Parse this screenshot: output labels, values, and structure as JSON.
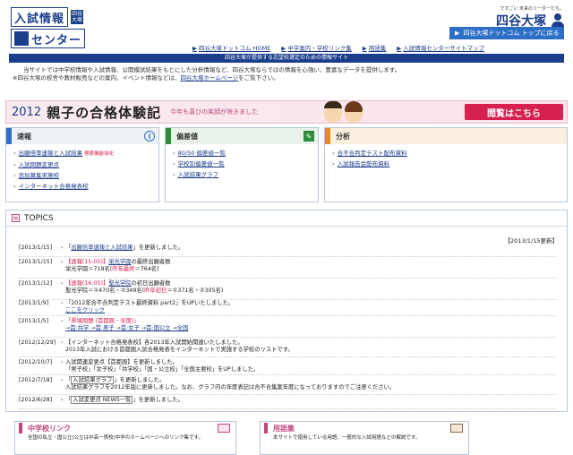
{
  "header": {
    "logo_line1": "入試情報",
    "logo_mini": "四谷大塚",
    "logo_line2": "センター",
    "brand_tagline": "ですごい 未来のリーダーたち。",
    "brand_name": "四谷大塚",
    "top_button": "四谷大塚ドットコム トップに戻る",
    "nav": [
      "四谷大塚ドットコム HOME",
      "中学案内・学校リンク集",
      "用語集",
      "入試情報センターサイトマップ"
    ],
    "banner_bar": "四谷大塚が提供する志望校選定のための情報サイト",
    "intro_1": "当サイトでは中学校情報や入試情報、公開模試結果をもとにした分析情報など、四谷大塚ならではの情報を心強い、豊富なデータを提供します。",
    "intro_2_pre": "※四谷大塚の校舎や教材販売などの案内、イベント情報などは、",
    "intro_2_link": "四谷大塚ホームページ",
    "intro_2_post": "をご覧下さい。"
  },
  "banner": {
    "year": "2012",
    "title": "親子の合格体験記",
    "subtitle": "今年も喜びの笑顔が咲きました",
    "view_button": "閲覧はこちら"
  },
  "panels": [
    {
      "title": "速報",
      "color": "#2e6fc6",
      "icon": "info-icon",
      "items": [
        "出願倍率速報と入試結果",
        "入試問題変更点",
        "追加募集実施校",
        "インターネット合格発表校"
      ],
      "new_tag": "検索機能強化"
    },
    {
      "title": "偏差値",
      "color": "#2f8a3a",
      "icon": "edit-icon",
      "items": [
        "80/50 偏差値一覧",
        "学校別偏差値一覧",
        "入試結果グラフ"
      ]
    },
    {
      "title": "分析",
      "color": "#e58a1f",
      "icon": "",
      "items": [
        "合不合判定テスト配布資料",
        "入試報告会配布資料"
      ]
    }
  ],
  "topics": {
    "title": "TOPICS",
    "updated": "【2013/1/15更新】",
    "rows": [
      {
        "date": "[2013/1/15]",
        "parts": [
          {
            "t": "「"
          },
          {
            "t": "出願倍率速報と入試結果",
            "link": true
          },
          {
            "t": "」を更新しました。"
          }
        ]
      },
      {
        "date": "[2013/1/15]",
        "parts": [
          {
            "t": "【速報(15:05)】",
            "red": true
          },
          {
            "t": "栄光学園",
            "link": true
          },
          {
            "t": "の最終出願者数"
          }
        ],
        "line2": [
          {
            "t": "栄光学園＝718名("
          },
          {
            "t": "昨年最終",
            "red": true
          },
          {
            "t": "＝764名)"
          }
        ]
      },
      {
        "date": "[2013/1/12]",
        "parts": [
          {
            "t": "【速報(16:05)】",
            "red": true
          },
          {
            "t": "聖光学院",
            "link": true
          },
          {
            "t": "の初日出願者数"
          }
        ],
        "line2": [
          {
            "t": "聖光学院＝①470名・②349名("
          },
          {
            "t": "昨年初日",
            "red": true
          },
          {
            "t": "＝①371名・②305名)"
          }
        ]
      },
      {
        "date": "[2013/1/9]",
        "parts": [
          {
            "t": "「2012年合不合判定テスト最終資料 part2」をUPいたしました。"
          }
        ],
        "line2": [
          {
            "t": "ここをクリック",
            "link": true
          }
        ]
      },
      {
        "date": "[2013/1/5]",
        "parts": [
          {
            "t": "「県境問題 (首都圏・全国)」",
            "red": true
          }
        ],
        "line2": [
          {
            "t": "→首:共学 →首:男子 →首:女子 →首:国公立 →全国",
            "link": true
          }
        ]
      },
      {
        "date": "[2012/12/29]",
        "parts": [
          {
            "t": "【インターネット合格発表校】各2013年入試開始関連いたしました。"
          }
        ],
        "line2": [
          {
            "t": "2013年入試における首都圏入試合格発表をインターネットで実施する学校のリストです。"
          }
        ]
      },
      {
        "date": "[2012/10/7]",
        "parts": [
          {
            "t": "入試関連変更点【首都圏】を更新しました。"
          }
        ],
        "line2": [
          {
            "t": "「男子校」「女子校」「共学校」「国・公立校」「全国主要校」をUPしました。"
          }
        ]
      },
      {
        "date": "[2012/7/18]",
        "parts": [
          {
            "t": "「"
          },
          {
            "t": "入試結果グラフ",
            "box": true
          },
          {
            "t": "」を更新しました。"
          }
        ],
        "line2": [
          {
            "t": "入試結果グラフを2012年版に更新しました。なお、グラフ内の年度表記は合不合集案年度になっておりますのでご注意ください。"
          }
        ]
      },
      {
        "date": "[2012/6/28]",
        "parts": [
          {
            "t": "「"
          },
          {
            "t": "入試変更点 NEWS一覧",
            "box": true
          },
          {
            "t": "」を更新しました。"
          }
        ]
      }
    ]
  },
  "bottom": [
    {
      "title": "中学校リンク",
      "text": "全国の私立・国公立(公立は中高一貫校)中学のホームページへのリンク集です。"
    },
    {
      "title": "用語集",
      "text": "本サイトで使用している用語、一般的な入試用語などの解説です。"
    }
  ]
}
